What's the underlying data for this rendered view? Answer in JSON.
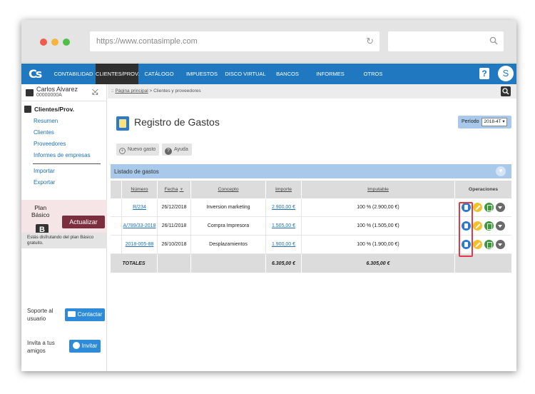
{
  "browser": {
    "url": "https://www.contasimple.com",
    "reload_icon": "reload-icon",
    "search_icon": "search-icon"
  },
  "nav": {
    "logo": "Cs",
    "items": [
      "CONTABILIDAD",
      "CLIENTES/PROV.",
      "CATÁLOGO",
      "IMPUESTOS",
      "DISCO VIRTUAL",
      "BANCOS",
      "INFORMES",
      "OTROS"
    ],
    "active_index": 1,
    "help_label": "?",
    "avatar_initial": "S",
    "color": "#1f78c0"
  },
  "user": {
    "name": "Carlos Alvarez",
    "id": "00000000A"
  },
  "sidebar": {
    "section_title": "Clientes/Prov.",
    "links_top": [
      "Resumen",
      "Clientes",
      "Proveedores",
      "Informes de empresas"
    ],
    "links_bottom": [
      "Importar",
      "Exportar"
    ],
    "plan_label_line1": "Plan",
    "plan_label_line2": "Básico",
    "plan_badge": "B",
    "upgrade_label": "Actualizar",
    "plan_note": "Estás disfrutando del plan Básico gratuito.",
    "support_line1": "Soporte al",
    "support_line2": "usuario",
    "contact_label": "Contactar",
    "invite_line1": "Invita a tus",
    "invite_line2": "amigos",
    "invite_label": "Invitar"
  },
  "breadcrumb": {
    "prefix": "::",
    "home": "Página principal",
    "current": "> Clientes y proveedores"
  },
  "page": {
    "title": "Registro de Gastos",
    "period_label": "Período",
    "period_value": "2018-4T ▾",
    "new_label": "Nuevo gasto",
    "help_label": "Ayuda",
    "list_title": "Listado de gastos"
  },
  "table": {
    "headers": {
      "numero": "Número",
      "fecha": "Fecha",
      "concepto": "Concepto",
      "importe": "Importe",
      "imputable": "Imputable",
      "operaciones": "Operaciones"
    },
    "rows": [
      {
        "numero": "R/234",
        "fecha": "26/12/2018",
        "concepto": "Inversion marketing",
        "importe": "2.900,00 €",
        "imputable": "100 %  (2.900,00 €)"
      },
      {
        "numero": "A/789/33-2018",
        "fecha": "26/11/2018",
        "concepto": "Compra Impresora",
        "importe": "1.505,00 €",
        "imputable": "100 %  (1.505,00 €)"
      },
      {
        "numero": "2018-005-88",
        "fecha": "26/10/2018",
        "concepto": "Desplazamientos",
        "importe": "1.900,00 €",
        "imputable": "100 %  (1.900,00 €)"
      }
    ],
    "totals": {
      "label": "TOTALES",
      "importe": "6.305,00 €",
      "imputable": "6.305,00 €"
    }
  },
  "colors": {
    "accent": "#1f78c0",
    "upgrade": "#7a2e3e",
    "highlight": "#e0394a"
  }
}
